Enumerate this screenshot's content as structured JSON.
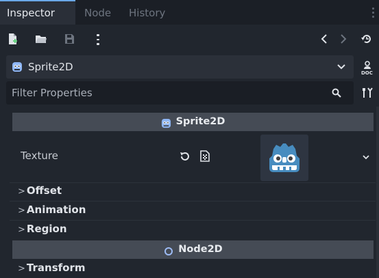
{
  "tabs": [
    {
      "label": "Inspector",
      "active": true
    },
    {
      "label": "Node",
      "active": false
    },
    {
      "label": "History",
      "active": false
    }
  ],
  "toolbar": {
    "icons": [
      "new-resource-icon",
      "open-folder-icon",
      "save-icon",
      "more-icon",
      "history-back-icon",
      "history-forward-icon",
      "object-history-icon"
    ]
  },
  "selector": {
    "label": "Sprite2D",
    "icon": "sprite2d-icon"
  },
  "filter": {
    "placeholder": "Filter Properties"
  },
  "sections": {
    "sprite2d": "Sprite2D",
    "node2d": "Node2D"
  },
  "texture": {
    "label": "Texture"
  },
  "subsections": {
    "offset": "Offset",
    "animation": "Animation",
    "region": "Region",
    "transform": "Transform"
  },
  "colors": {
    "accent": "#6aa8e8",
    "sprite_icon": "#8eb6f5",
    "node2d_icon": "#9dbbf4",
    "godot_logo": "#478cbf"
  }
}
